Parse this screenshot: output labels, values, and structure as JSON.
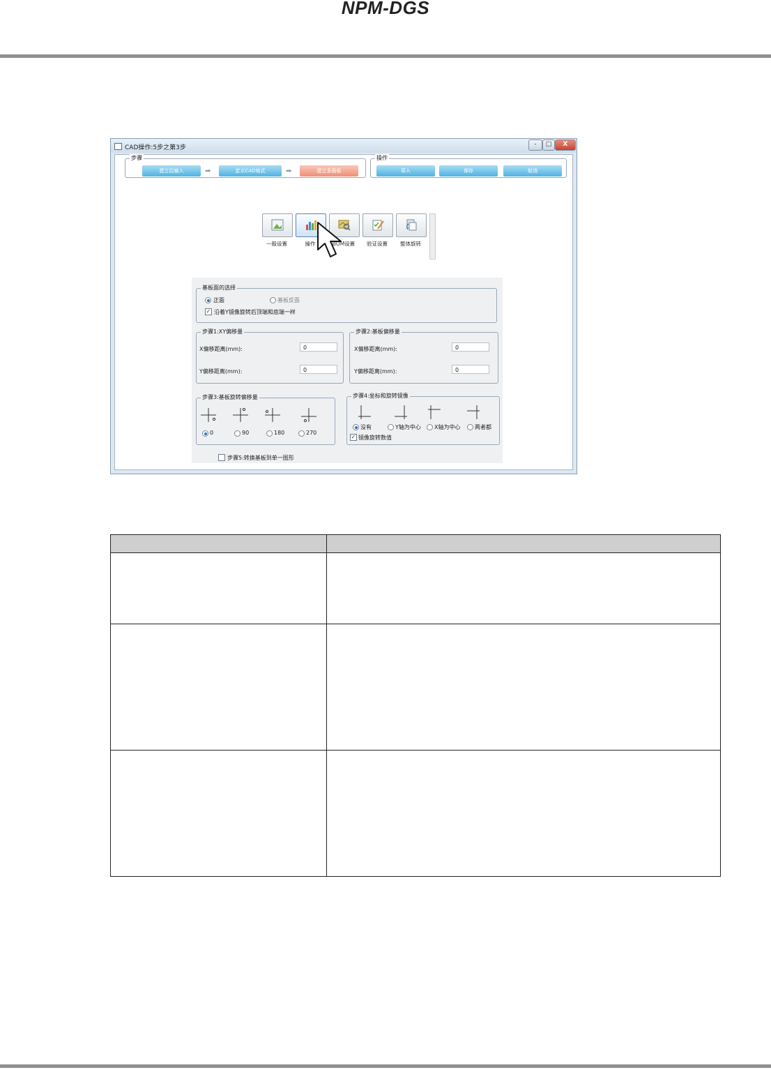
{
  "document": {
    "header_title": "NPM-DGS"
  },
  "dialog": {
    "title": "CAD操作:5步之第3步",
    "window_buttons": {
      "minimize": "-",
      "maximize": "□",
      "close": "X"
    },
    "steps_group": {
      "label": "步骤",
      "steps": [
        {
          "label": "建立后输入"
        },
        {
          "label": "定义CAD格式"
        },
        {
          "label": "建立多面板"
        }
      ]
    },
    "actions_group": {
      "label": "操作",
      "buttons": [
        {
          "label": "导入"
        },
        {
          "label": "保存"
        },
        {
          "label": "取消"
        }
      ]
    },
    "toolbar": [
      {
        "label": "一般设置",
        "icon": "image-settings-icon"
      },
      {
        "label": "操作",
        "icon": "bar-chart-icon"
      },
      {
        "label": "BOM设置",
        "icon": "map-search-icon"
      },
      {
        "label": "验证设置",
        "icon": "checklist-edit-icon"
      },
      {
        "label": "整体旋转",
        "icon": "rotate-icon"
      }
    ],
    "board_side": {
      "label": "基板面的选择",
      "options": [
        {
          "label": "正面",
          "selected": true
        },
        {
          "label": "基板反面",
          "selected": false
        }
      ],
      "mirror_checkbox": {
        "label": "沿着Y镜像旋转后顶端和底端一样",
        "checked": true
      }
    },
    "step1": {
      "label": "步骤1:XY偏移量",
      "x_label": "X偏移距离(mm):",
      "x_value": "0",
      "y_label": "Y偏移距离(mm):",
      "y_value": "0"
    },
    "step2": {
      "label": "步骤2:基板偏移量",
      "x_label": "X偏移距离(mm):",
      "x_value": "0",
      "y_label": "Y偏移距离(mm):",
      "y_value": "0"
    },
    "step3": {
      "label": "步骤3:基板旋转偏移量",
      "options": [
        {
          "label": "0",
          "selected": true
        },
        {
          "label": "90",
          "selected": false
        },
        {
          "label": "180",
          "selected": false
        },
        {
          "label": "270",
          "selected": false
        }
      ]
    },
    "step4": {
      "label": "步骤4:坐标和旋转镜像",
      "options": [
        {
          "label": "没有",
          "selected": true
        },
        {
          "label": "Y轴为中心",
          "selected": false
        },
        {
          "label": "X轴为中心",
          "selected": false
        },
        {
          "label": "两者都",
          "selected": false
        }
      ],
      "mirror_checkbox": {
        "label": "镜像旋转数值",
        "checked": true
      }
    },
    "step5": {
      "label": "步骤5:转换基板到单一图形",
      "checked": false
    }
  },
  "colors": {
    "step_button": "#4eb3e4",
    "active_step": "#f18f77",
    "header_rule": "#8f8f8f",
    "table_header": "#cfcfcf"
  }
}
